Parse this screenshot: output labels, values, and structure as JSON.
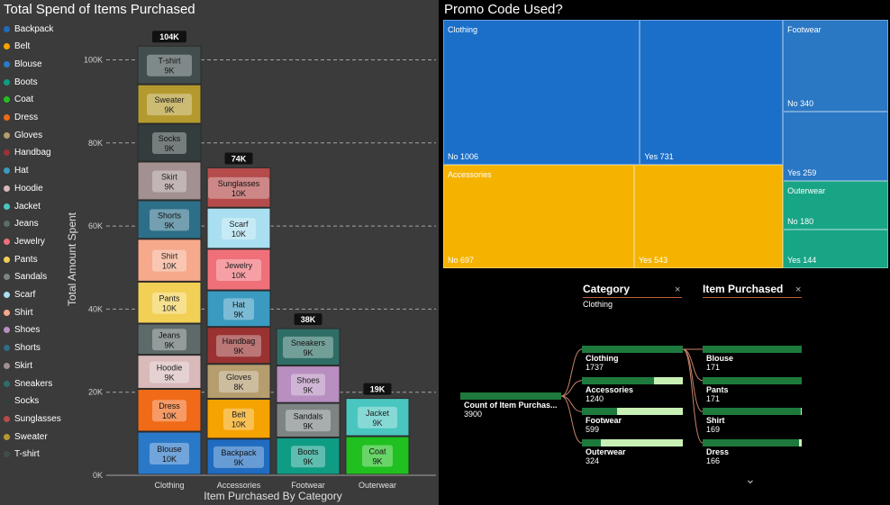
{
  "left": {
    "title": "Total Spend of Items Purchased",
    "legend": [
      {
        "label": "Backpack",
        "color": "#1f6cc0"
      },
      {
        "label": "Belt",
        "color": "#f5a300"
      },
      {
        "label": "Blouse",
        "color": "#2a79c9"
      },
      {
        "label": "Boots",
        "color": "#0f9c85"
      },
      {
        "label": "Coat",
        "color": "#20c020"
      },
      {
        "label": "Dress",
        "color": "#f06a18"
      },
      {
        "label": "Gloves",
        "color": "#b59d6e"
      },
      {
        "label": "Handbag",
        "color": "#9a3232"
      },
      {
        "label": "Hat",
        "color": "#3a9ac0"
      },
      {
        "label": "Hoodie",
        "color": "#d9b9ba"
      },
      {
        "label": "Jacket",
        "color": "#4ac6c0"
      },
      {
        "label": "Jeans",
        "color": "#5e6a6a"
      },
      {
        "label": "Jewelry",
        "color": "#f0707a"
      },
      {
        "label": "Pants",
        "color": "#f2cf55"
      },
      {
        "label": "Sandals",
        "color": "#7e8484"
      },
      {
        "label": "Scarf",
        "color": "#a9dff0"
      },
      {
        "label": "Shirt",
        "color": "#f6a98b"
      },
      {
        "label": "Shoes",
        "color": "#b88fc0"
      },
      {
        "label": "Shorts",
        "color": "#2d6e88"
      },
      {
        "label": "Skirt",
        "color": "#a39090"
      },
      {
        "label": "Sneakers",
        "color": "#2e6e66"
      },
      {
        "label": "Socks",
        "color": "#333d3d"
      },
      {
        "label": "Sunglasses",
        "color": "#b54b4b"
      },
      {
        "label": "Sweater",
        "color": "#b49a2e"
      },
      {
        "label": "T-shirt",
        "color": "#424e4e"
      }
    ]
  },
  "chart_data": {
    "type": "bar",
    "stacked": true,
    "title": "Total Spend of Items Purchased",
    "xlabel": "Item Purchased By Category",
    "ylabel": "Total Amount Spent",
    "ylim": [
      0,
      104000
    ],
    "yticks": [
      {
        "v": 0,
        "label": "0K"
      },
      {
        "v": 20000,
        "label": "20K"
      },
      {
        "v": 40000,
        "label": "40K"
      },
      {
        "v": 60000,
        "label": "60K"
      },
      {
        "v": 80000,
        "label": "80K"
      },
      {
        "v": 100000,
        "label": "100K"
      }
    ],
    "grid": true,
    "legend_position": "left",
    "categories": [
      "Clothing",
      "Accessories",
      "Footwear",
      "Outerwear"
    ],
    "totals": [
      "104K",
      "74K",
      "38K",
      "19K"
    ],
    "stacks": [
      [
        {
          "item": "Blouse",
          "value": 10400,
          "label": "10K",
          "color": "#2a79c9"
        },
        {
          "item": "Dress",
          "value": 10300,
          "label": "10K",
          "color": "#f06a18"
        },
        {
          "item": "Hoodie",
          "value": 8200,
          "label": "9K",
          "color": "#d9b9ba"
        },
        {
          "item": "Jeans",
          "value": 7500,
          "label": "9K",
          "color": "#5e6a6a"
        },
        {
          "item": "Pants",
          "value": 10100,
          "label": "10K",
          "color": "#f2cf55"
        },
        {
          "item": "Shirt",
          "value": 10300,
          "label": "10K",
          "color": "#f6a98b"
        },
        {
          "item": "Shorts",
          "value": 9300,
          "label": "9K",
          "color": "#2d6e88"
        },
        {
          "item": "Skirt",
          "value": 9300,
          "label": "9K",
          "color": "#a39090"
        },
        {
          "item": "Socks",
          "value": 9100,
          "label": "9K",
          "color": "#333d3d"
        },
        {
          "item": "Sweater",
          "value": 9500,
          "label": "9K",
          "color": "#b49a2e"
        },
        {
          "item": "T-shirt",
          "value": 9300,
          "label": "9K",
          "color": "#424e4e"
        }
      ],
      [
        {
          "item": "Backpack",
          "value": 8700,
          "label": "9K",
          "color": "#1f6cc0"
        },
        {
          "item": "Belt",
          "value": 9600,
          "label": "10K",
          "color": "#f5a300"
        },
        {
          "item": "Gloves",
          "value": 8400,
          "label": "8K",
          "color": "#b59d6e"
        },
        {
          "item": "Handbag",
          "value": 8900,
          "label": "9K",
          "color": "#9a3232"
        },
        {
          "item": "Hat",
          "value": 8800,
          "label": "9K",
          "color": "#3a9ac0"
        },
        {
          "item": "Jewelry",
          "value": 10000,
          "label": "10K",
          "color": "#f0707a"
        },
        {
          "item": "Scarf",
          "value": 9900,
          "label": "10K",
          "color": "#a9dff0"
        },
        {
          "item": "Sunglasses",
          "value": 9700,
          "label": "10K",
          "color": "#b54b4b"
        }
      ],
      [
        {
          "item": "Boots",
          "value": 9000,
          "label": "9K",
          "color": "#0f9c85"
        },
        {
          "item": "Sandals",
          "value": 8300,
          "label": "9K",
          "color": "#7e8484"
        },
        {
          "item": "Shoes",
          "value": 9000,
          "label": "9K",
          "color": "#b88fc0"
        },
        {
          "item": "Sneakers",
          "value": 9000,
          "label": "9K",
          "color": "#2e6e66"
        }
      ],
      [
        {
          "item": "Coat",
          "value": 9300,
          "label": "9K",
          "color": "#20c020"
        },
        {
          "item": "Jacket",
          "value": 9200,
          "label": "9K",
          "color": "#4ac6c0"
        }
      ]
    ]
  },
  "treemap": {
    "title": "Promo Code Used?",
    "groups": [
      {
        "name": "Clothing",
        "color": "#1b6fc9",
        "cells": [
          {
            "label": "No",
            "count": 1006
          },
          {
            "label": "Yes",
            "count": 731
          }
        ]
      },
      {
        "name": "Accessories",
        "color": "#f5b300",
        "cells": [
          {
            "label": "No",
            "count": 697
          },
          {
            "label": "Yes",
            "count": 543
          }
        ]
      },
      {
        "name": "Footwear",
        "color": "#2a77c4",
        "cells": [
          {
            "label": "No",
            "count": 340
          },
          {
            "label": "Yes",
            "count": 259
          }
        ]
      },
      {
        "name": "Outerwear",
        "color": "#18a586",
        "cells": [
          {
            "label": "No",
            "count": 180
          },
          {
            "label": "Yes",
            "count": 144
          }
        ]
      }
    ]
  },
  "decomp": {
    "category_header": "Category",
    "category_value": "Clothing",
    "item_header": "Item Purchased",
    "close_glyph": "×",
    "expand_glyph": "⌄",
    "root": {
      "label": "Count of Item Purchas...",
      "value": "3900"
    },
    "categories": [
      {
        "name": "Clothing",
        "value": "1737",
        "fill": 1.0,
        "selected": true
      },
      {
        "name": "Accessories",
        "value": "1240",
        "fill": 0.714
      },
      {
        "name": "Footwear",
        "value": "599",
        "fill": 0.345
      },
      {
        "name": "Outerwear",
        "value": "324",
        "fill": 0.187
      }
    ],
    "items": [
      {
        "name": "Blouse",
        "value": "171",
        "fill": 1.0
      },
      {
        "name": "Pants",
        "value": "171",
        "fill": 1.0
      },
      {
        "name": "Shirt",
        "value": "169",
        "fill": 0.988
      },
      {
        "name": "Dress",
        "value": "166",
        "fill": 0.971
      }
    ]
  }
}
